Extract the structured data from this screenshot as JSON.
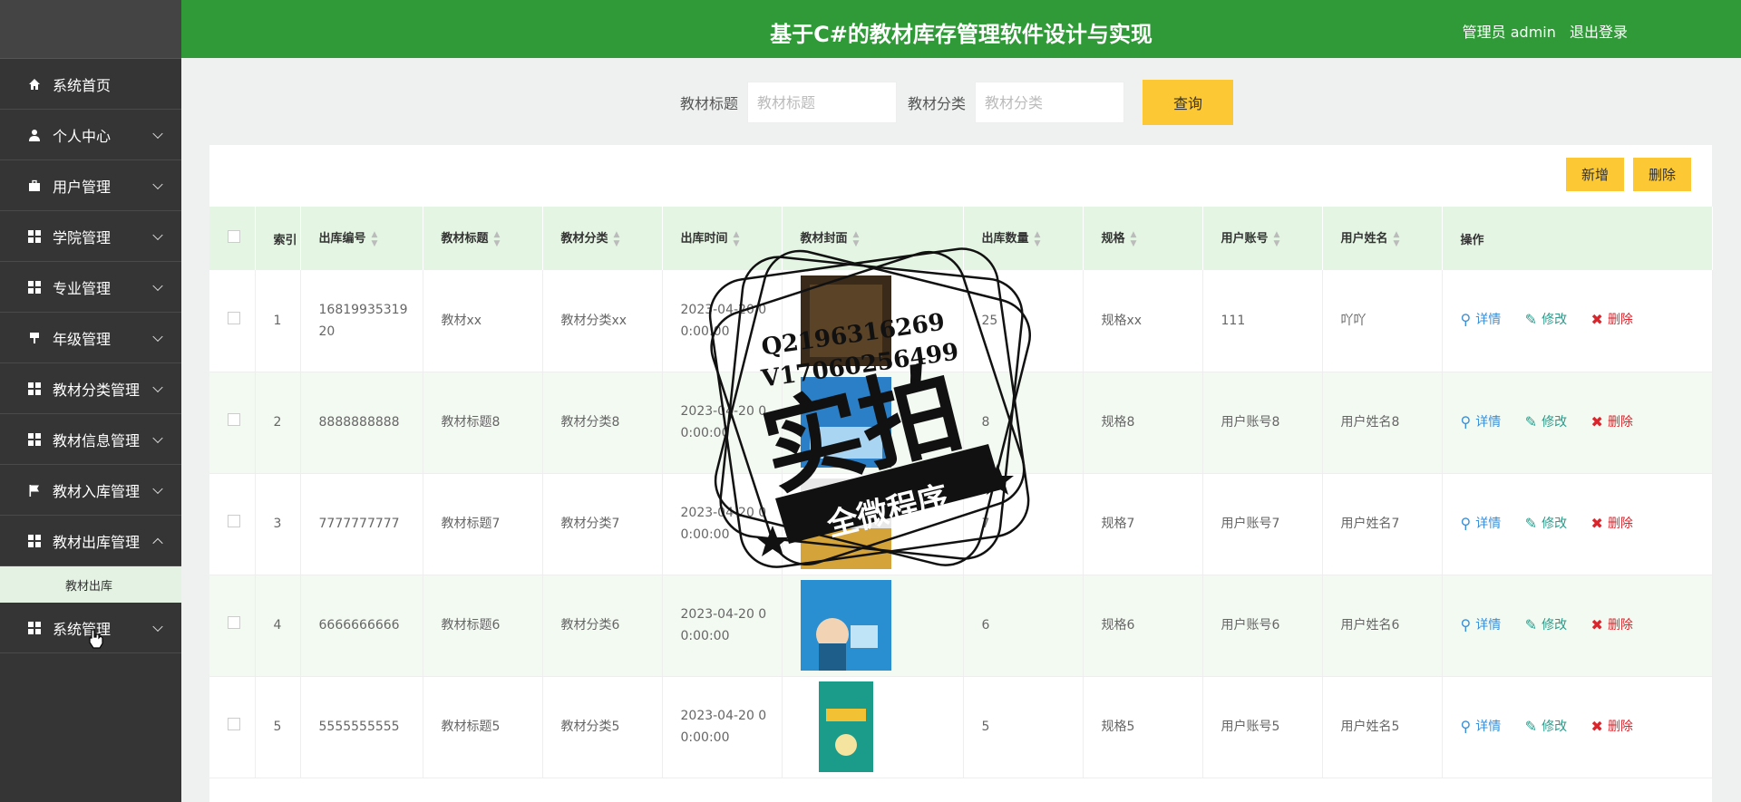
{
  "header": {
    "title": "基于C#的教材库存管理软件设计与实现",
    "user": "管理员 admin",
    "logout": "退出登录"
  },
  "sidebar": {
    "items": [
      {
        "label": "系统首页",
        "icon": "home-icon"
      },
      {
        "label": "个人中心",
        "icon": "user-icon"
      },
      {
        "label": "用户管理",
        "icon": "briefcase-icon"
      },
      {
        "label": "学院管理",
        "icon": "grid-icon"
      },
      {
        "label": "专业管理",
        "icon": "grid-icon"
      },
      {
        "label": "年级管理",
        "icon": "pin-icon"
      },
      {
        "label": "教材分类管理",
        "icon": "grid-icon"
      },
      {
        "label": "教材信息管理",
        "icon": "grid-icon"
      },
      {
        "label": "教材入库管理",
        "icon": "flag-icon"
      },
      {
        "label": "教材出库管理",
        "icon": "grid-icon"
      },
      {
        "label": "系统管理",
        "icon": "grid-icon"
      }
    ],
    "submenu": "教材出库"
  },
  "search": {
    "title_label": "教材标题",
    "title_placeholder": "教材标题",
    "category_label": "教材分类",
    "category_placeholder": "教材分类",
    "query_button": "查询"
  },
  "actions": {
    "add": "新增",
    "delete": "删除"
  },
  "table": {
    "headers": [
      "索引",
      "出库编号",
      "教材标题",
      "教材分类",
      "出库时间",
      "教材封面",
      "出库数量",
      "规格",
      "用户账号",
      "用户姓名",
      "操作"
    ],
    "rows": [
      {
        "index": "1",
        "code": "1681993531920",
        "title": "教材xx",
        "category": "教材分类xx",
        "time": "2023-04-20 00:00:00",
        "qty": "25",
        "spec": "规格xx",
        "account": "111",
        "name": "吖吖"
      },
      {
        "index": "2",
        "code": "8888888888",
        "title": "教材标题8",
        "category": "教材分类8",
        "time": "2023-04-20 00:00:00",
        "qty": "8",
        "spec": "规格8",
        "account": "用户账号8",
        "name": "用户姓名8"
      },
      {
        "index": "3",
        "code": "7777777777",
        "title": "教材标题7",
        "category": "教材分类7",
        "time": "2023-04-20 00:00:00",
        "qty": "7",
        "spec": "规格7",
        "account": "用户账号7",
        "name": "用户姓名7"
      },
      {
        "index": "4",
        "code": "6666666666",
        "title": "教材标题6",
        "category": "教材分类6",
        "time": "2023-04-20 00:00:00",
        "qty": "6",
        "spec": "规格6",
        "account": "用户账号6",
        "name": "用户姓名6"
      },
      {
        "index": "5",
        "code": "5555555555",
        "title": "教材标题5",
        "category": "教材分类5",
        "time": "2023-04-20 00:00:00",
        "qty": "5",
        "spec": "规格5",
        "account": "用户账号5",
        "name": "用户姓名5"
      }
    ],
    "ops": {
      "detail": "详情",
      "edit": "修改",
      "delete": "删除"
    }
  },
  "watermark": {
    "line1": "Q2196316269",
    "line2": "V17060256499",
    "main": "实拍",
    "banner": "全微程序"
  },
  "colors": {
    "header": "#2f9a37",
    "sidebar": "#353535",
    "accent": "#fcc833",
    "row_alt": "#f3faf2"
  }
}
